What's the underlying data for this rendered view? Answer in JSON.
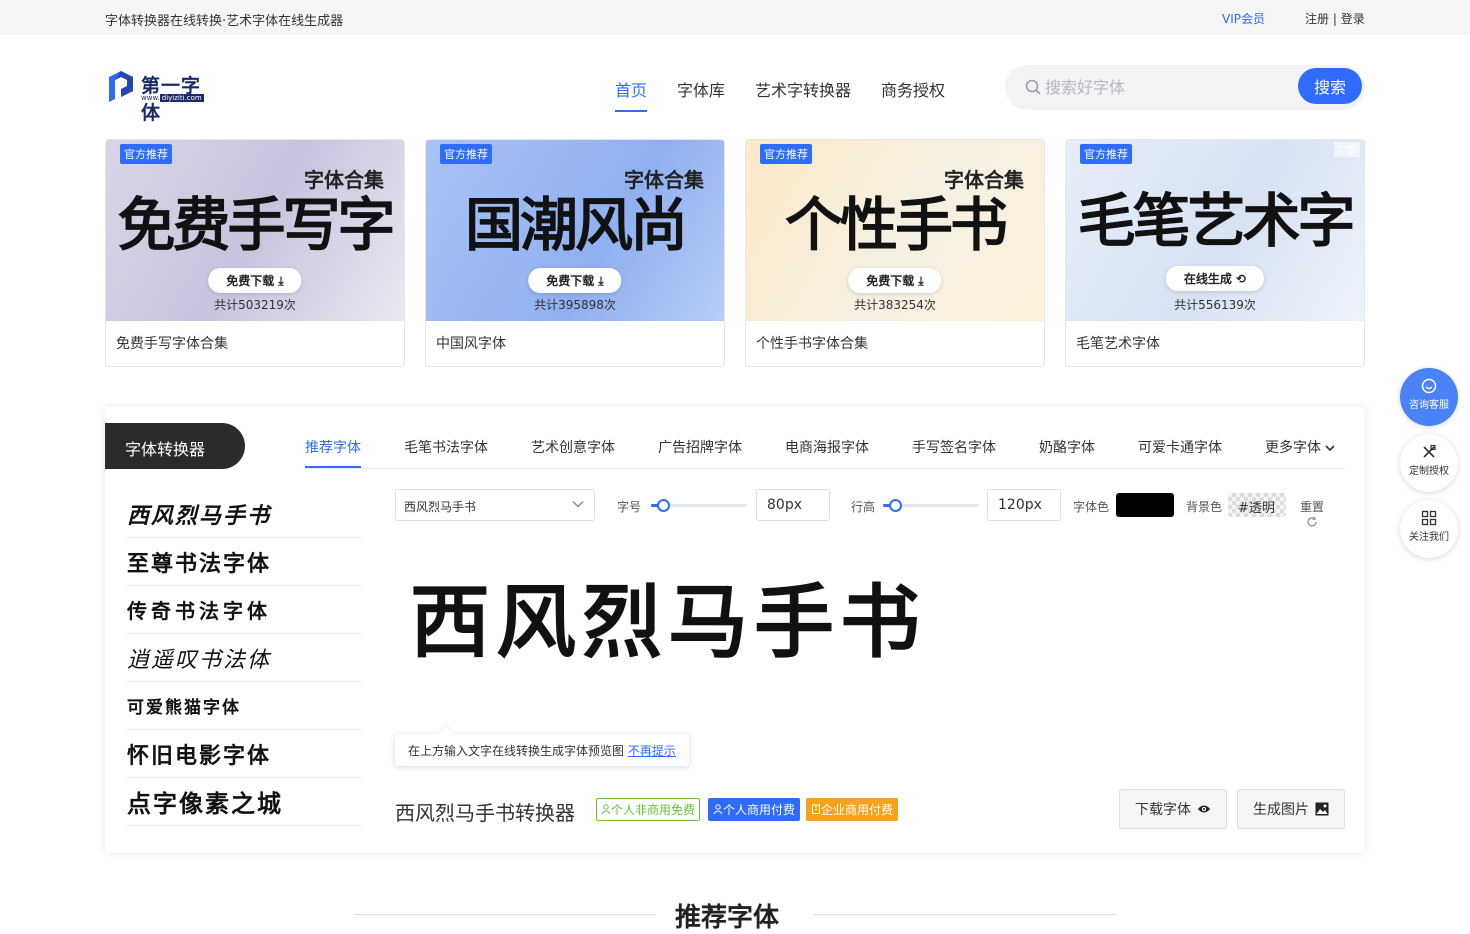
{
  "topbar": {
    "site_title": "字体转换器在线转换·艺术字体在线生成器",
    "vip": "VIP会员",
    "register": "注册",
    "separator": " | ",
    "login": "登录"
  },
  "logo": {
    "name": "第一字体",
    "url_prefix": "www.",
    "url_domain": "diyiziti.com"
  },
  "nav": [
    {
      "label": "首页",
      "active": true
    },
    {
      "label": "字体库",
      "active": false
    },
    {
      "label": "艺术字转换器",
      "active": false
    },
    {
      "label": "商务授权",
      "active": false
    }
  ],
  "search": {
    "placeholder": "搜索好字体",
    "button": "搜索"
  },
  "cards": [
    {
      "tag": "官方推荐",
      "big": "免费手写字",
      "small": "字体合集",
      "action": "免费下载 ⤓",
      "count": "共计503219次",
      "title": "免费手写字体合集",
      "bg": "linear-gradient(120deg,#d9d6e6,#c8c3de 50%,#ebe8f1)"
    },
    {
      "tag": "官方推荐",
      "big": "国潮风尚",
      "small": "字体合集",
      "action": "免费下载 ⤓",
      "count": "共计395898次",
      "title": "中国风字体",
      "bg": "linear-gradient(120deg,#a9c3f5,#8fb0f0 60%,#b8cdf7)"
    },
    {
      "tag": "官方推荐",
      "big": "个性手书",
      "small": "字体合集",
      "action": "免费下载 ⤓",
      "count": "共计383254次",
      "title": "个性手书字体合集",
      "bg": "linear-gradient(120deg,#fbe9c8,#f6f0e2 55%,#fdf1dc)"
    },
    {
      "tag": "官方推荐",
      "big": "毛笔艺术字",
      "small": "",
      "action": "在线生成 ⟲",
      "count": "共计556139次",
      "title": "毛笔艺术字体",
      "ad": "广告",
      "bg": "linear-gradient(120deg,#e6edf8,#d7e2f3 55%,#eef3fa)"
    }
  ],
  "panel": {
    "title": "字体转换器",
    "categories": [
      {
        "label": "推荐字体",
        "active": true
      },
      {
        "label": "毛笔书法字体",
        "active": false
      },
      {
        "label": "艺术创意字体",
        "active": false
      },
      {
        "label": "广告招牌字体",
        "active": false
      },
      {
        "label": "电商海报字体",
        "active": false
      },
      {
        "label": "手写签名字体",
        "active": false
      },
      {
        "label": "奶酪字体",
        "active": false
      },
      {
        "label": "可爱卡通字体",
        "active": false
      },
      {
        "label": "更多字体",
        "active": false
      }
    ],
    "fonts": [
      "西风烈马手书",
      "至尊书法字体",
      "传奇书法字体",
      "逍遥叹书法体",
      "可爱熊猫字体",
      "怀旧电影字体",
      "点字像素之城",
      "…"
    ],
    "controls": {
      "selected_font": "西风烈马手书",
      "size_label": "字号",
      "size_value": "80px",
      "size_level": 0.12,
      "lineheight_label": "行高",
      "lineheight_value": "120px",
      "lineheight_level": 0.12,
      "color_label": "字体色",
      "color": "#000000",
      "bg_label": "背景色",
      "bg_value": "#透明",
      "reset_label": "重置"
    },
    "preview_text": "西风烈马手书",
    "tip": {
      "text": "在上方输入文字在线转换生成字体预览图",
      "link": "不再提示"
    },
    "converter_title": "西风烈马手书转换器",
    "licenses": [
      "个人非商用免费",
      "个人商用付费",
      "企业商用付费"
    ],
    "download_button": "下载字体",
    "generate_button": "生成图片"
  },
  "section_title": "推荐字体",
  "side": [
    {
      "label": "咨询客服",
      "icon": "chat-icon"
    },
    {
      "label": "定制授权",
      "icon": "tools-icon"
    },
    {
      "label": "关注我们",
      "icon": "qrcode-icon"
    }
  ],
  "colors": {
    "accent": "#2f6bff",
    "green": "#67c23a",
    "orange": "#f7a21b",
    "dark": "#2b2b2b"
  }
}
